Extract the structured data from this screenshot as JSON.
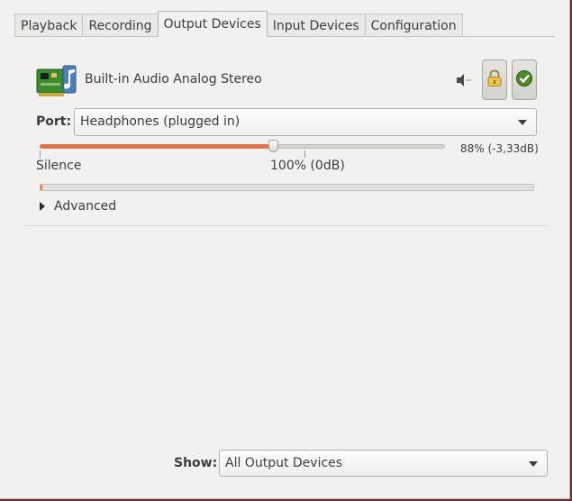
{
  "tabs": [
    {
      "label": "Playback"
    },
    {
      "label": "Recording"
    },
    {
      "label": "Output Devices",
      "active": true
    },
    {
      "label": "Input Devices"
    },
    {
      "label": "Configuration"
    }
  ],
  "device": {
    "name": "Built-in Audio Analog Stereo",
    "icon": "sound-card-icon",
    "mute_icon": "speaker-muted-icon",
    "lock_icon": "lock-icon",
    "default_icon": "checkmark-icon"
  },
  "port": {
    "label": "Port:",
    "value": "Headphones (plugged in)"
  },
  "volume": {
    "level_percent": 88,
    "readout": "88% (-3,33dB)",
    "mark_silence": "Silence",
    "mark_100": "100% (0dB)"
  },
  "meter": {
    "level_fraction": 0.004
  },
  "advanced": {
    "label": "Advanced",
    "expanded": false
  },
  "show": {
    "label": "Show:",
    "value": "All Output Devices"
  },
  "colors": {
    "accent": "#e2734a",
    "window_bg": "#f2f1f0",
    "desktop_bg": "#7a2a2a"
  }
}
